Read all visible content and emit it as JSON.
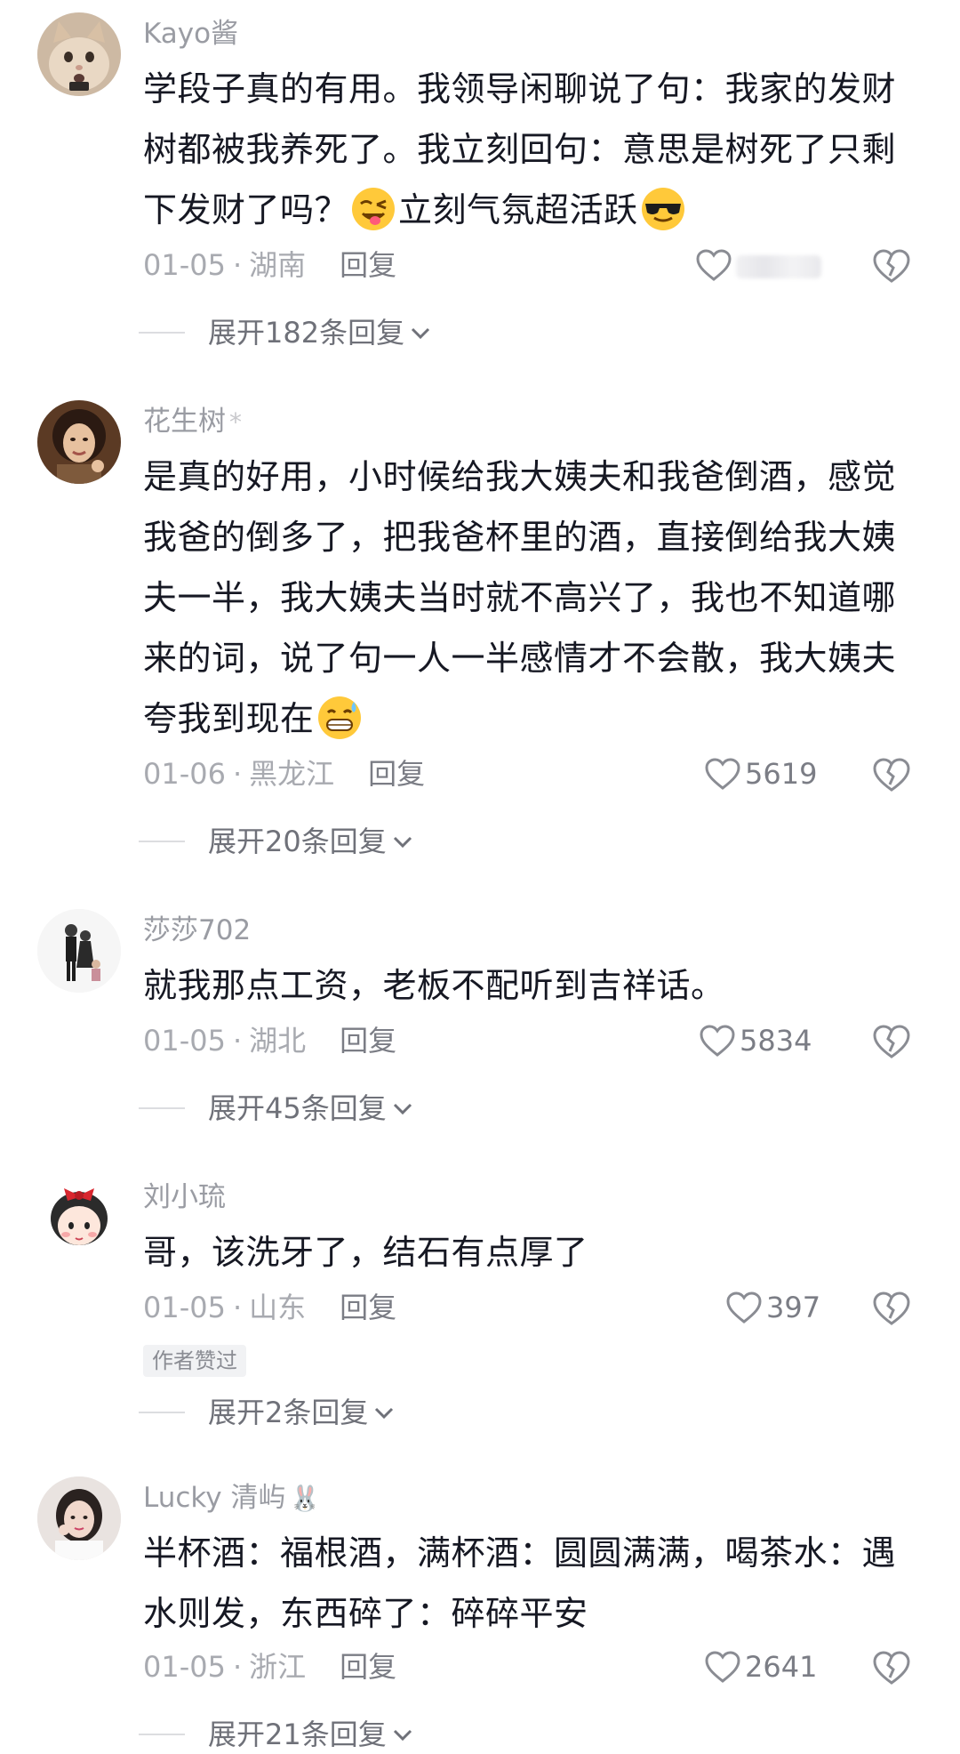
{
  "comments": [
    {
      "username": "Kayo酱",
      "flair": "",
      "text_parts": [
        "学段子真的有用。我领导闲聊说了句：我家的发财树都被我养死了。我立刻回句：意思是树死了只剩下发财了吗？",
        "立刻气氛超活跃"
      ],
      "emojis": [
        "winking-tongue-emoji",
        "sunglasses-emoji"
      ],
      "date": "01-05",
      "location": "湖南",
      "reply_label": "回复",
      "likes": "",
      "likes_hidden": true,
      "expand_label": "展开182条回复"
    },
    {
      "username": "花生树",
      "flair": "*",
      "text_parts": [
        "是真的好用，小时候给我大姨夫和我爸倒酒，感觉我爸的倒多了，把我爸杯里的酒，直接倒给我大姨夫一半，我大姨夫当时就不高兴了，我也不知道哪来的词，说了句一人一半感情才不会散，我大姨夫夸我到现在"
      ],
      "emojis": [
        "sweat-grin-emoji"
      ],
      "date": "01-06",
      "location": "黑龙江",
      "reply_label": "回复",
      "likes": "5619",
      "expand_label": "展开20条回复"
    },
    {
      "username": "莎莎702",
      "flair": "",
      "text_parts": [
        "就我那点工资，老板不配听到吉祥话。"
      ],
      "emojis": [],
      "date": "01-05",
      "location": "湖北",
      "reply_label": "回复",
      "likes": "5834",
      "expand_label": "展开45条回复"
    },
    {
      "username": "刘小琉",
      "flair": "",
      "text_parts": [
        "哥，该洗牙了，结石有点厚了"
      ],
      "emojis": [],
      "date": "01-05",
      "location": "山东",
      "reply_label": "回复",
      "likes": "397",
      "badge": "作者赞过",
      "expand_label": "展开2条回复"
    },
    {
      "username": "Lucky 清屿",
      "flair": "🐰",
      "text_parts": [
        "半杯酒：福根酒，满杯酒：圆圆满满，喝茶水：遇水则发，东西碎了：碎碎平安"
      ],
      "emojis": [],
      "date": "01-05",
      "location": "浙江",
      "reply_label": "回复",
      "likes": "2641",
      "expand_label": "展开21条回复"
    }
  ],
  "colors": {
    "text": "#161823",
    "secondary": "#a8aab0",
    "reply": "#7b7d85"
  }
}
